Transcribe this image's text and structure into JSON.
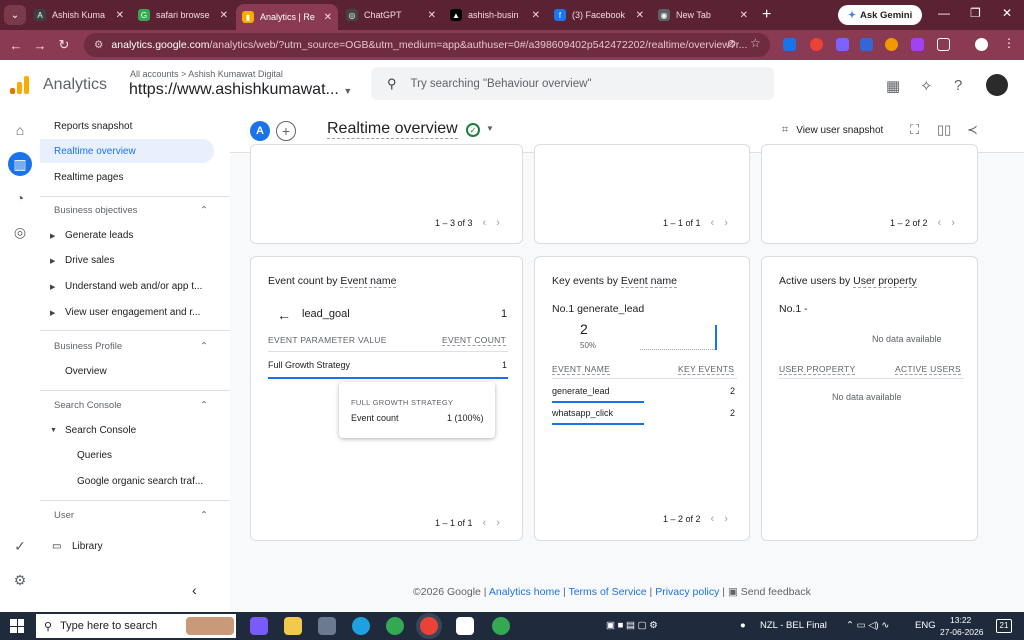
{
  "browser": {
    "tabs": [
      {
        "label": "Ashish Kuma",
        "fav_color": "#3c4043",
        "fav_glyph": "A"
      },
      {
        "label": "safari browse",
        "fav_color": "#34a853",
        "fav_glyph": "G"
      },
      {
        "label": "Analytics | Re",
        "fav_color": "#f9ab00",
        "fav_glyph": "▮"
      },
      {
        "label": "ChatGPT",
        "fav_color": "#444",
        "fav_glyph": "◎"
      },
      {
        "label": "ashish-busin",
        "fav_color": "#000",
        "fav_glyph": "▲"
      },
      {
        "label": "(3) Facebook",
        "fav_color": "#1877f2",
        "fav_glyph": "f"
      },
      {
        "label": "New Tab",
        "fav_color": "#5f6368",
        "fav_glyph": "◉"
      }
    ],
    "gemini_label": "Ask Gemini",
    "url_host": "analytics.google.com",
    "url_path": "/analytics/web/?utm_source=OGB&utm_medium=app&authuser=0#/a398609402p542472202/realtime/overview?r..."
  },
  "header": {
    "app_name": "Analytics",
    "crumbs": "All accounts > Ashish Kumawat Digital",
    "property": "https://www.ashishkumawat...",
    "search_placeholder": "Try searching \"Behaviour overview\""
  },
  "sidebar": {
    "top": [
      "Reports snapshot",
      "Realtime overview",
      "Realtime pages"
    ],
    "business_objectives": {
      "title": "Business objectives",
      "items": [
        "Generate leads",
        "Drive sales",
        "Understand web and/or app t...",
        "View user engagement and r..."
      ]
    },
    "business_profile": {
      "title": "Business Profile",
      "items": [
        "Overview"
      ]
    },
    "search_console": {
      "title": "Search Console",
      "parent": "Search Console",
      "items": [
        "Queries",
        "Google organic search traf..."
      ]
    },
    "user": {
      "title": "User",
      "items": [
        "Library"
      ]
    }
  },
  "toolbar": {
    "badge": "A",
    "title": "Realtime overview",
    "snapshot_label": "View user snapshot"
  },
  "top_cards": {
    "pagers": [
      "1 – 3 of 3",
      "1 – 1 of 1",
      "1 – 2 of 2"
    ]
  },
  "event_card": {
    "title_prefix": "Event count by ",
    "title_dim": "Event name",
    "event": "lead_goal",
    "event_value": "1",
    "col1": "EVENT PARAMETER VALUE",
    "col2": "EVENT COUNT",
    "row_label": "Full Growth Strategy",
    "row_value": "1",
    "tooltip_title": "FULL GROWTH STRATEGY",
    "tooltip_label": "Event count",
    "tooltip_value": "1 (100%)",
    "pager": "1 – 1 of 1"
  },
  "key_card": {
    "title_prefix": "Key events by ",
    "title_dim": "Event name",
    "top_label": "No.1  generate_lead",
    "top_value": "2",
    "top_pct": "50%",
    "col1": "EVENT NAME",
    "col2": "KEY EVENTS",
    "rows": [
      {
        "name": "generate_lead",
        "value": "2"
      },
      {
        "name": "whatsapp_click",
        "value": "2"
      }
    ],
    "pager": "1 – 2 of 2"
  },
  "users_card": {
    "title_prefix": "Active users by ",
    "title_dim": "User property",
    "top_label": "No.1  -",
    "no_data": "No data available",
    "col1": "USER PROPERTY",
    "col2": "ACTIVE USERS",
    "no_data2": "No data available"
  },
  "footer": {
    "copyright": "©2026 Google | ",
    "home": "Analytics home",
    "terms": "Terms of Service",
    "privacy": "Privacy policy",
    "feedback": "Send feedback"
  },
  "taskbar": {
    "search_placeholder": "Type here to search",
    "weather": "NZL - BEL Final",
    "lang": "ENG",
    "time": "13:22",
    "date": "27-06-2026",
    "notif": "21"
  },
  "colors": {
    "accent": "#1a73e8",
    "browser": "#8a3a52",
    "ga_orange": "#f9ab00"
  }
}
